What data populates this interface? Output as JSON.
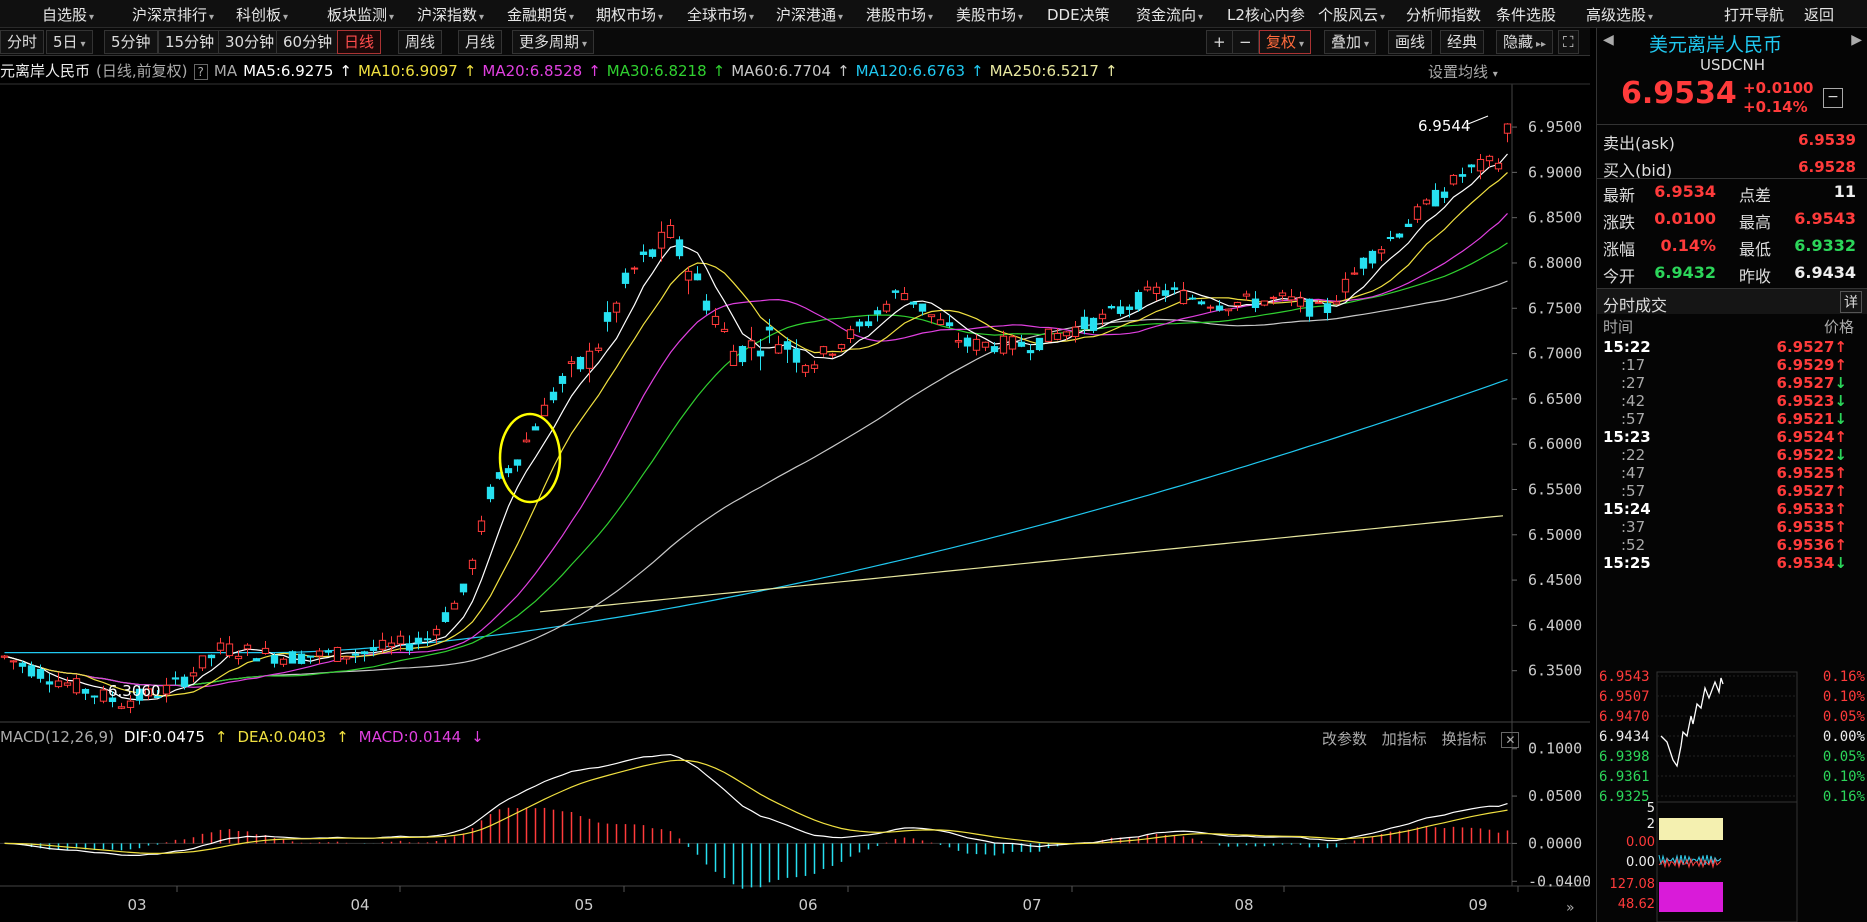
{
  "topbar": {
    "items": [
      {
        "label": "自选股",
        "dropdown": true
      },
      {
        "label": "沪深京排行",
        "dropdown": true
      },
      {
        "label": "科创板",
        "dropdown": true
      },
      {
        "label": "板块监测",
        "dropdown": true
      },
      {
        "label": "沪深指数",
        "dropdown": true
      },
      {
        "label": "金融期货",
        "dropdown": true
      },
      {
        "label": "期权市场",
        "dropdown": true
      },
      {
        "label": "全球市场",
        "dropdown": true
      },
      {
        "label": "沪深港通",
        "dropdown": true
      },
      {
        "label": "港股市场",
        "dropdown": true
      },
      {
        "label": "美股市场",
        "dropdown": true
      },
      {
        "label": "DDE决策",
        "dropdown": false
      },
      {
        "label": "资金流向",
        "dropdown": true
      },
      {
        "label": "L2核心内参",
        "dropdown": false
      },
      {
        "label": "个股风云",
        "dropdown": true
      },
      {
        "label": "分析师指数",
        "dropdown": false
      },
      {
        "label": "条件选股",
        "dropdown": false
      },
      {
        "label": "高级选股",
        "dropdown": true
      }
    ],
    "open_nav": "打开导航",
    "back": "返回"
  },
  "periodbar": {
    "buttons": [
      "分时",
      "5日",
      "5分钟",
      "15分钟",
      "30分钟",
      "60分钟",
      "日线",
      "周线",
      "月线",
      "更多周期"
    ],
    "active": "日线",
    "right_buttons": [
      "+",
      "−",
      "复权",
      "叠加",
      "画线",
      "经典",
      "隐藏"
    ]
  },
  "infoline": {
    "name": "元离岸人民币",
    "mode": "(日线,前复权)",
    "qmark": "?",
    "ma_label": "MA",
    "ma5": "MA5:6.9275",
    "ma10": "MA10:6.9097",
    "ma20": "MA20:6.8528",
    "ma30": "MA30:6.8218",
    "ma60": "MA60:6.7704",
    "ma120": "MA120:6.6763",
    "ma250": "MA250:6.5217",
    "set_ma": "设置均线"
  },
  "macd": {
    "label": "MACD(12,26,9)",
    "dif": "DIF:0.0475",
    "dea": "DEA:0.0403",
    "macd": "MACD:0.0144",
    "btn_params": "改参数",
    "btn_add": "加指标",
    "btn_switch": "换指标"
  },
  "colors": {
    "up": "#ff3b3b",
    "down": "#27e0f0",
    "ma5": "#ffffff",
    "ma10": "#f0e040",
    "ma20": "#e040e0",
    "ma30": "#30d030",
    "ma60": "#c8c8c8",
    "ma120": "#20c8f0",
    "ma250": "#e8e8a0"
  },
  "chart_data": {
    "type": "candlestick",
    "y_axis_ticks": [
      "6.9500",
      "6.9000",
      "6.8500",
      "6.8000",
      "6.7500",
      "6.7000",
      "6.6500",
      "6.6000",
      "6.5500",
      "6.5000",
      "6.4500",
      "6.4000",
      "6.3500"
    ],
    "ylim": [
      6.3,
      6.96
    ],
    "x_axis_ticks": [
      "03",
      "04",
      "05",
      "06",
      "07",
      "08",
      "09"
    ],
    "high_label": "6.9544",
    "low_label": "6.3060",
    "macd_ticks": [
      "0.1000",
      "0.0500",
      "0.0000",
      "-0.0400"
    ],
    "macd_ylim": [
      -0.045,
      0.105
    ]
  },
  "quote": {
    "title": "美元离岸人民币",
    "code": "USDCNH",
    "price": "6.9534",
    "change": "+0.0100",
    "change_pct": "+0.14%",
    "ask_label": "卖出(ask)",
    "ask": "6.9539",
    "bid_label": "买入(bid)",
    "bid": "6.9528",
    "stats": [
      {
        "label": "最新",
        "value": "6.9534",
        "label2": "点差",
        "value2": "11"
      },
      {
        "label": "涨跌",
        "value": "0.0100",
        "label2": "最高",
        "value2": "6.9543"
      },
      {
        "label": "涨幅",
        "value": "0.14%",
        "label2": "最低",
        "value2": "6.9332"
      },
      {
        "label": "今开",
        "value": "6.9432",
        "label2": "昨收",
        "value2": "6.9434"
      }
    ],
    "trades_title": "分时成交",
    "trades_detail": "详",
    "time_header": "时间",
    "price_header": "价格",
    "trades": [
      {
        "time": "15:22",
        "price": "6.9527",
        "dir": "up",
        "bold": true
      },
      {
        "time": ":17",
        "price": "6.9529",
        "dir": "up",
        "bold": false
      },
      {
        "time": ":27",
        "price": "6.9527",
        "dir": "down",
        "bold": false
      },
      {
        "time": ":42",
        "price": "6.9523",
        "dir": "down",
        "bold": false
      },
      {
        "time": ":57",
        "price": "6.9521",
        "dir": "down",
        "bold": false
      },
      {
        "time": "15:23",
        "price": "6.9524",
        "dir": "up",
        "bold": true
      },
      {
        "time": ":22",
        "price": "6.9522",
        "dir": "down",
        "bold": false
      },
      {
        "time": ":47",
        "price": "6.9525",
        "dir": "up",
        "bold": false
      },
      {
        "time": ":57",
        "price": "6.9527",
        "dir": "up",
        "bold": false
      },
      {
        "time": "15:24",
        "price": "6.9533",
        "dir": "up",
        "bold": true
      },
      {
        "time": ":37",
        "price": "6.9535",
        "dir": "up",
        "bold": false
      },
      {
        "time": ":52",
        "price": "6.9536",
        "dir": "up",
        "bold": false
      },
      {
        "time": "15:25",
        "price": "6.9534",
        "dir": "down",
        "bold": true
      }
    ],
    "mini": {
      "left_ticks": [
        "6.9543",
        "6.9507",
        "6.9470",
        "6.9434",
        "6.9398",
        "6.9361",
        "6.9325"
      ],
      "right_ticks": [
        "0.16%",
        "0.10%",
        "0.05%",
        "0.00%",
        "0.05%",
        "0.10%",
        "0.16%"
      ],
      "vol_ticks": [
        "5",
        "2",
        "0.00"
      ],
      "ind_ticks": [
        "0.00"
      ],
      "ind2_ticks": [
        "127.08",
        "48.62"
      ]
    }
  }
}
